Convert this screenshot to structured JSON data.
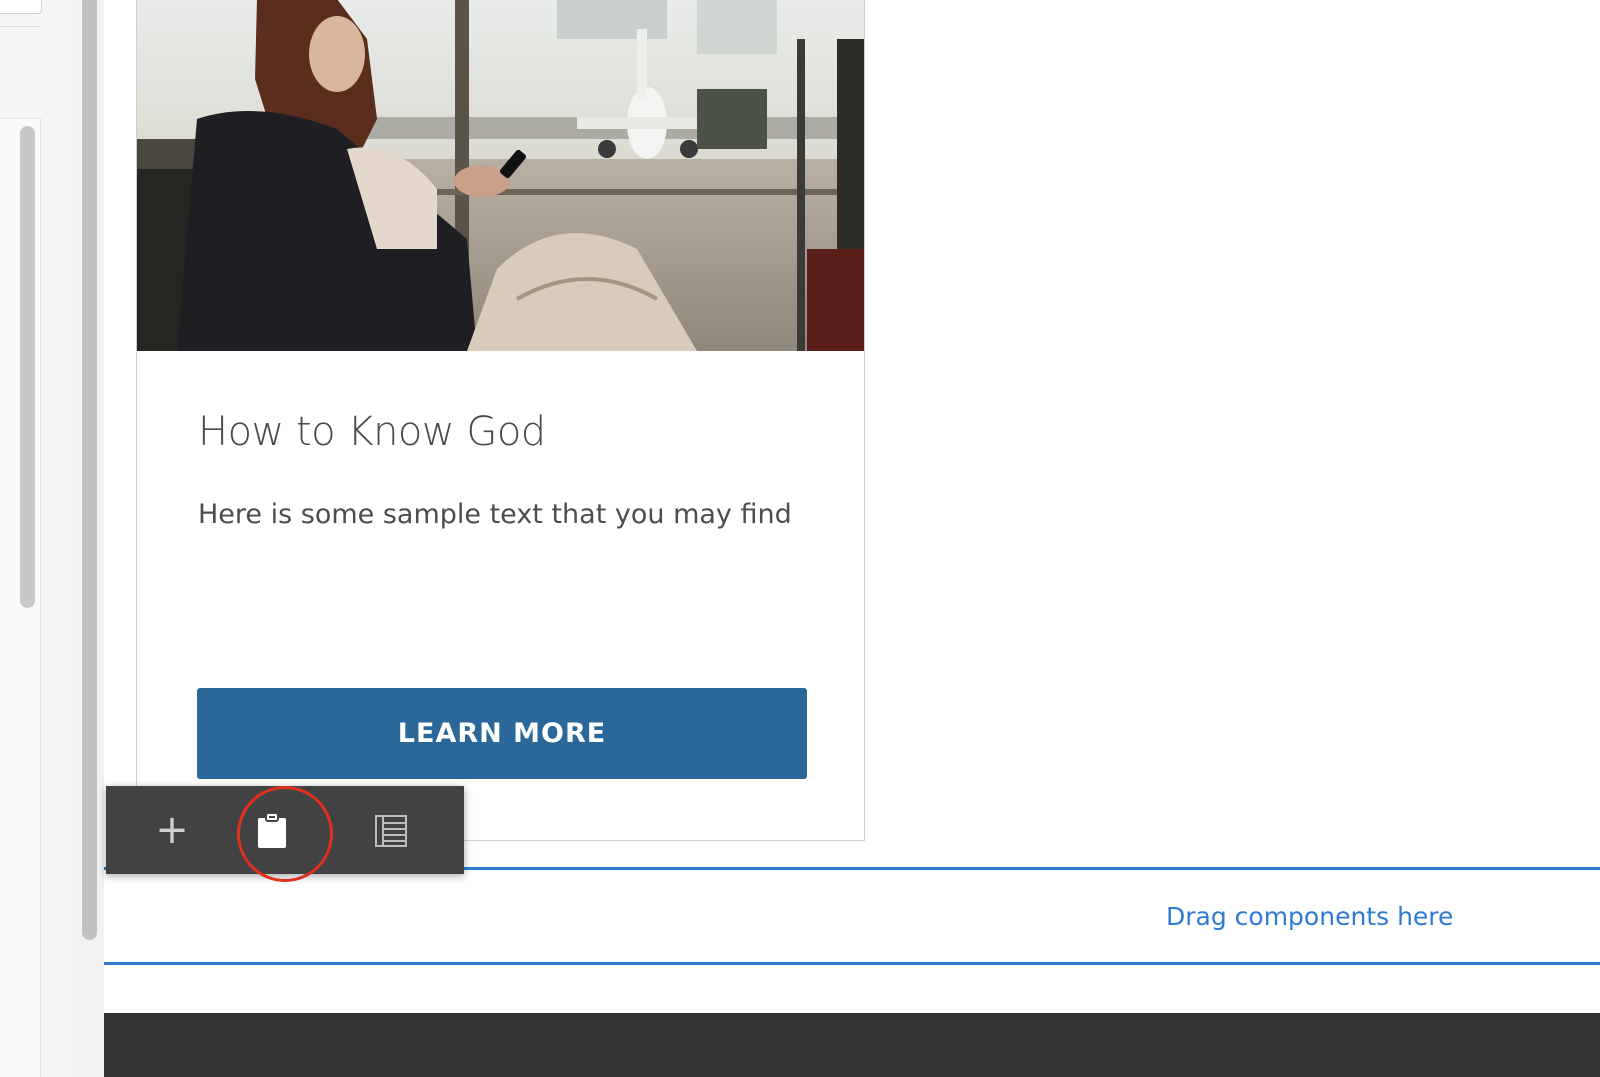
{
  "card": {
    "title": "How to Know God",
    "body_text": "Here is some sample text that you may find",
    "button_label": "LEARN MORE",
    "button_color": "#2b6899",
    "image_subject": "woman-using-phone-at-airport-window"
  },
  "dropzone": {
    "label": "Drag components here",
    "accent_color": "#2f7bd4"
  },
  "toolbar": {
    "items": [
      {
        "icon": "plus-icon",
        "action": "insert-component"
      },
      {
        "icon": "clipboard-icon",
        "action": "paste",
        "highlighted": true
      },
      {
        "icon": "parent-table-icon",
        "action": "select-parent"
      }
    ],
    "background": "#424242"
  },
  "colors": {
    "highlight_ring": "#e0301e",
    "footer": "#333333"
  }
}
